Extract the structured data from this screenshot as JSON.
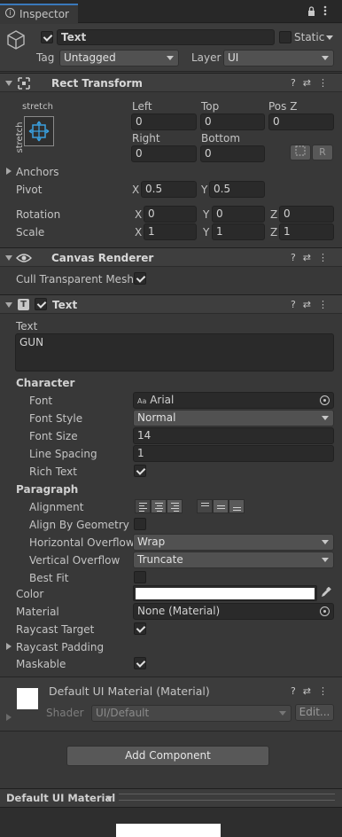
{
  "window": {
    "tab_title": "Inspector"
  },
  "object": {
    "name": "Text",
    "static_label": "Static",
    "tag_label": "Tag",
    "tag_value": "Untagged",
    "layer_label": "Layer",
    "layer_value": "UI"
  },
  "rect_transform": {
    "title": "Rect Transform",
    "anchor_preset_h": "stretch",
    "anchor_preset_v": "stretch",
    "left_label": "Left",
    "left_value": "0",
    "top_label": "Top",
    "top_value": "0",
    "posz_label": "Pos Z",
    "posz_value": "0",
    "right_label": "Right",
    "right_value": "0",
    "bottom_label": "Bottom",
    "bottom_value": "0",
    "r_button": "R",
    "anchors_label": "Anchors",
    "pivot_label": "Pivot",
    "pivot_x": "0.5",
    "pivot_y": "0.5",
    "rotation_label": "Rotation",
    "rot_x": "0",
    "rot_y": "0",
    "rot_z": "0",
    "scale_label": "Scale",
    "scale_x": "1",
    "scale_y": "1",
    "scale_z": "1",
    "x": "X",
    "y": "Y",
    "z": "Z"
  },
  "canvas_renderer": {
    "title": "Canvas Renderer",
    "cull_label": "Cull Transparent Mesh"
  },
  "text_component": {
    "title": "Text",
    "text_label": "Text",
    "text_value": "GUN",
    "character_label": "Character",
    "font_label": "Font",
    "font_value": "Arial",
    "font_prefix": "Aa",
    "font_style_label": "Font Style",
    "font_style_value": "Normal",
    "font_size_label": "Font Size",
    "font_size_value": "14",
    "line_spacing_label": "Line Spacing",
    "line_spacing_value": "1",
    "rich_text_label": "Rich Text",
    "paragraph_label": "Paragraph",
    "alignment_label": "Alignment",
    "align_geometry_label": "Align By Geometry",
    "horizontal_overflow_label": "Horizontal Overflow",
    "horizontal_overflow_value": "Wrap",
    "vertical_overflow_label": "Vertical Overflow",
    "vertical_overflow_value": "Truncate",
    "best_fit_label": "Best Fit",
    "color_label": "Color",
    "color_value": "#ffffff",
    "material_label": "Material",
    "material_value": "None (Material)",
    "raycast_target_label": "Raycast Target",
    "raycast_padding_label": "Raycast Padding",
    "maskable_label": "Maskable"
  },
  "material_preview": {
    "title": "Default UI Material (Material)",
    "shader_label": "Shader",
    "shader_value": "UI/Default",
    "edit_button": "Edit..."
  },
  "add_component": "Add Component",
  "preview_bar": {
    "title": "Default UI Material"
  },
  "colors": {
    "background": "#383838",
    "field": "#2a2a2a",
    "header": "#3e3e3e"
  }
}
